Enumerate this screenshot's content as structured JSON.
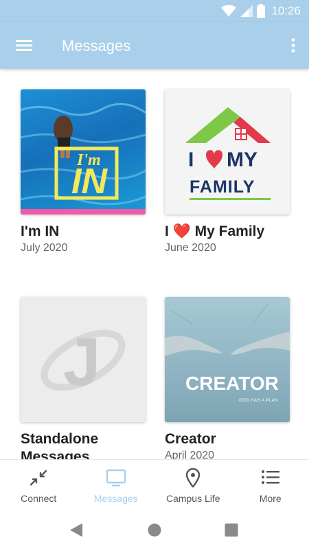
{
  "status": {
    "time": "10:26"
  },
  "app_bar": {
    "title": "Messages"
  },
  "cards": [
    {
      "title": "I'm IN",
      "date": "July 2020",
      "art_text_top": "I'm",
      "art_text_main": "IN"
    },
    {
      "title": "I ❤️ My Family",
      "date": "June 2020",
      "art_text_top": "I",
      "art_text_my": "MY",
      "art_text_main": "FAMILY"
    },
    {
      "title": "Standalone Messages",
      "date": "",
      "art_text_main": "J"
    },
    {
      "title": "Creator",
      "date": "April 2020",
      "art_text_main": "CREATOR",
      "art_text_sub": "GOD HAS A PLAN"
    }
  ],
  "nav": [
    {
      "label": "Connect",
      "icon": "connect-icon"
    },
    {
      "label": "Messages",
      "icon": "tv-icon"
    },
    {
      "label": "Campus Life",
      "icon": "location-pin-icon"
    },
    {
      "label": "More",
      "icon": "list-icon"
    }
  ],
  "colors": {
    "accent": "#a9cfea",
    "active_nav": "#a9cfea"
  }
}
